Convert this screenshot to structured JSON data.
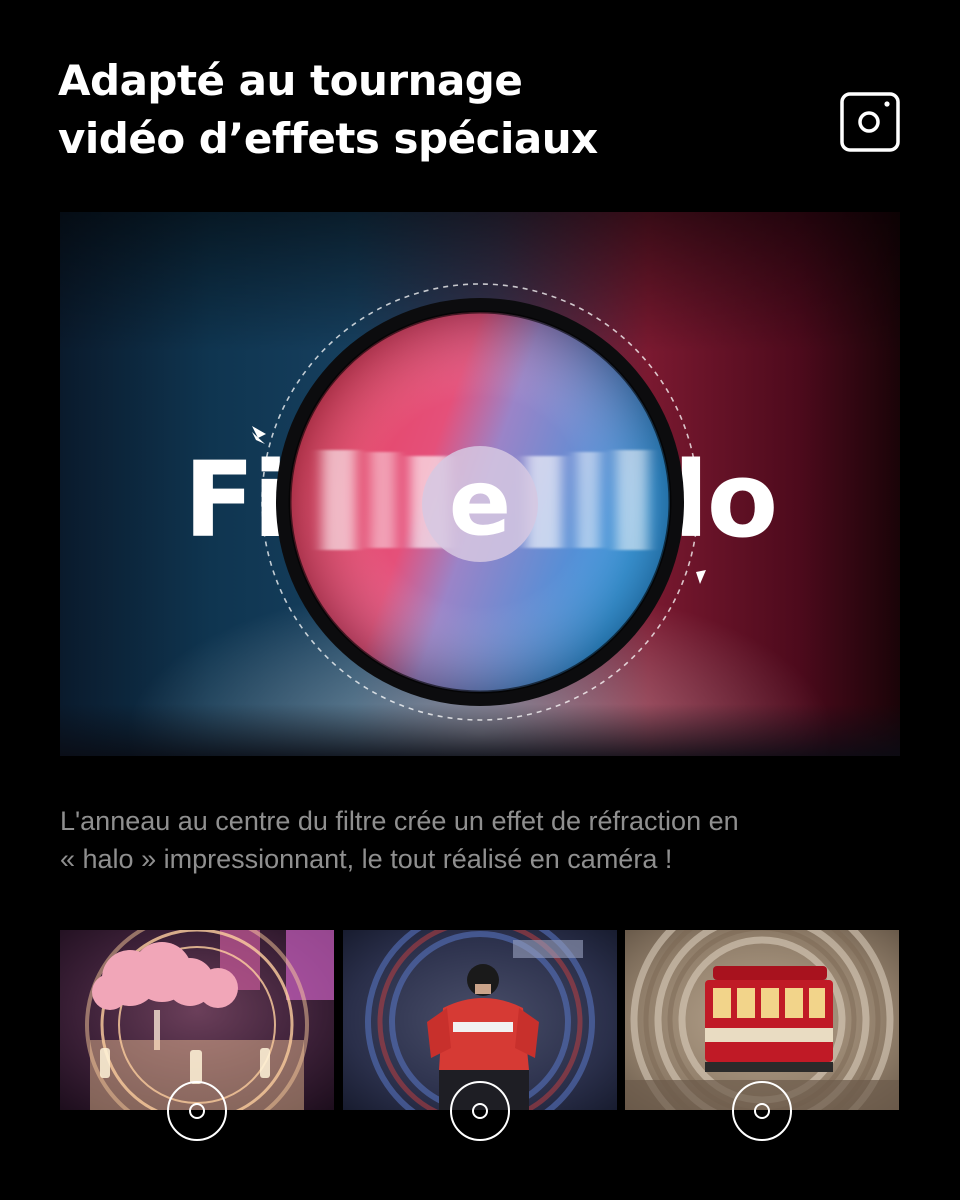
{
  "header": {
    "title_line1": "Adapté au tournage",
    "title_line2": "vidéo d’effets spéciaux"
  },
  "hero": {
    "title": "Filtre Halo"
  },
  "caption": {
    "line1": "L'anneau au centre du filtre crée un effet de réfraction en",
    "line2": "« halo » impressionnant, le tout réalisé en caméra !"
  },
  "icons": {
    "top_right": "camera-icon",
    "thumb_overlay": "target-ring-icon"
  },
  "thumbnails": [
    {
      "subject": "flower-arrangement-halo"
    },
    {
      "subject": "hockey-player-halo"
    },
    {
      "subject": "tram-halo"
    }
  ],
  "colors": {
    "background": "#000000",
    "headline": "#ffffff",
    "caption": "#8f8f8f",
    "accent_blue": "#3aa0e0",
    "accent_red": "#e0384e"
  }
}
